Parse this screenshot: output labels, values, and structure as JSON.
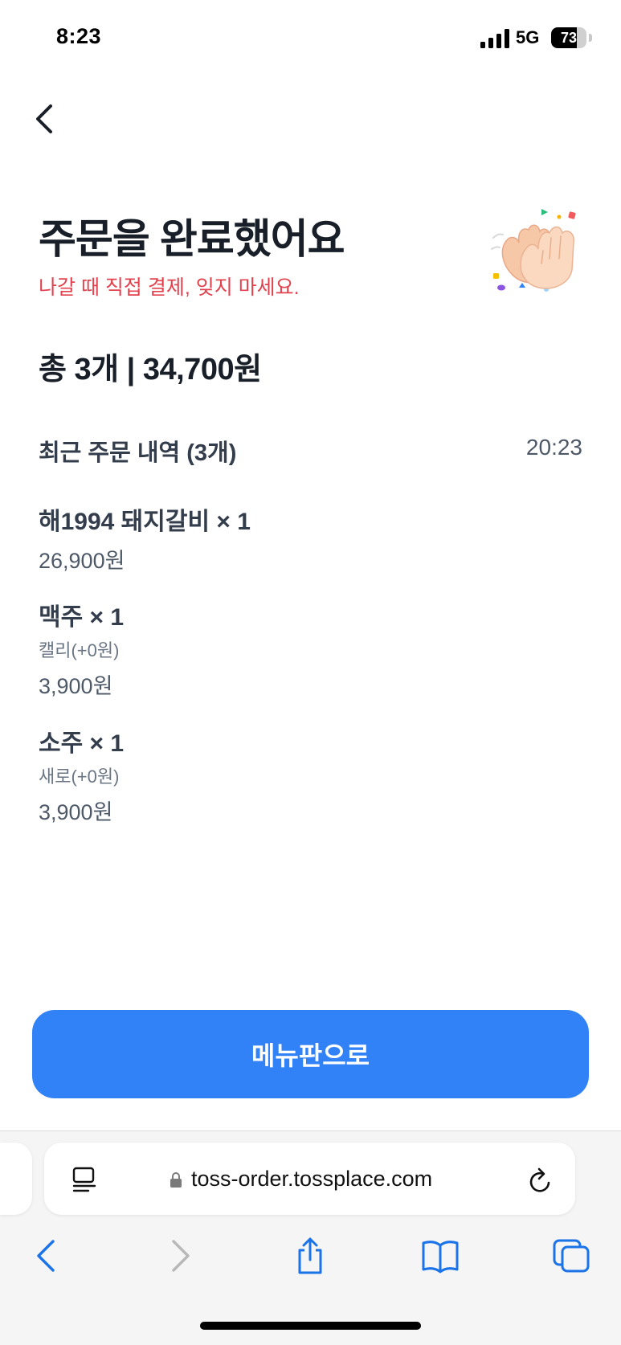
{
  "status_bar": {
    "time": "8:23",
    "network": "5G",
    "battery_level": "73",
    "battery_fraction": 0.73
  },
  "header": {
    "title": "주문을 완료했어요",
    "subtitle": "나갈 때 직접 결제, 잊지 마세요.",
    "illustration_icon": "clapping-hands-icon"
  },
  "summary": {
    "total": "총 3개 | 34,700원"
  },
  "recent_orders": {
    "label": "최근 주문 내역 (3개)",
    "time": "20:23",
    "items": [
      {
        "name": "해1994 돼지갈비 × 1",
        "option": "",
        "price": "26,900원"
      },
      {
        "name": "맥주 × 1",
        "option": "캘리(+0원)",
        "price": "3,900원"
      },
      {
        "name": "소주 × 1",
        "option": "새로(+0원)",
        "price": "3,900원"
      }
    ]
  },
  "cta": {
    "label": "메뉴판으로"
  },
  "browser": {
    "url": "toss-order.tossplace.com"
  },
  "colors": {
    "accent": "#3182f6",
    "warning_text": "#e2424e",
    "primary_text": "#191f28",
    "safari_blue": "#1a73e8"
  }
}
